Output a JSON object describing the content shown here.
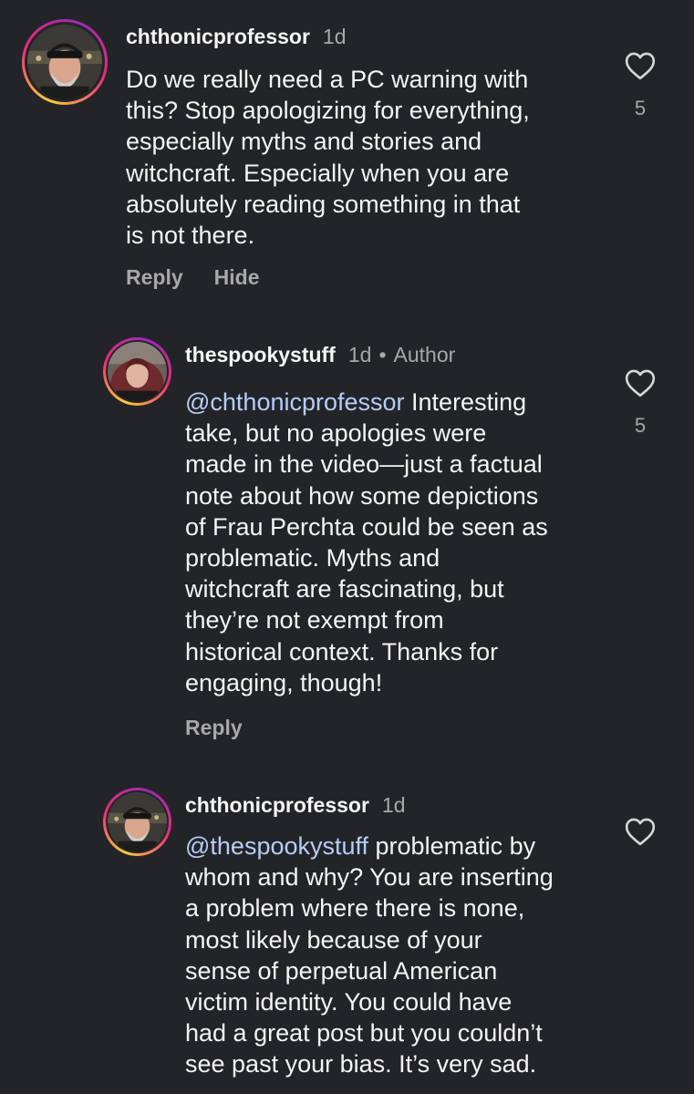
{
  "comments": [
    {
      "username": "chthonicprofessor",
      "time": "1d",
      "text": "Do we really need a PC warning with\nthis? Stop apologizing for everything,\nespecially myths and stories and\nwitchcraft. Especially when you are\nabsolutely reading something in that\nis not there.",
      "actions": [
        "Reply",
        "Hide"
      ],
      "likes": "5",
      "like_icon": "heart-outline-icon"
    },
    {
      "username": "thespookystuff",
      "time": "1d",
      "dot": "•",
      "badge": "Author",
      "mention": "@chthonicprofessor",
      "text": " Interesting\ntake, but no apologies were\nmade in the video—just a factual\nnote about how some depictions\nof Frau Perchta could be seen as\nproblematic. Myths and\nwitchcraft are fascinating, but\nthey’re not exempt from\nhistorical context. Thanks for\nengaging, though!",
      "actions": [
        "Reply"
      ],
      "likes": "5",
      "like_icon": "heart-outline-icon"
    },
    {
      "username": "chthonicprofessor",
      "time": "1d",
      "mention": "@thespookystuff",
      "text": " problematic by\nwhom and why? You are inserting\na problem where there is none,\nmost likely because of your\nsense of perpetual American\nvictim identity. You could have\nhad a great post but you couldn’t\nsee past your bias. It’s very sad.",
      "like_icon": "heart-outline-icon"
    }
  ],
  "colors": {
    "background": "#232428",
    "mention": "#b6cdf8",
    "secondary_text": "#a8a8a8"
  }
}
